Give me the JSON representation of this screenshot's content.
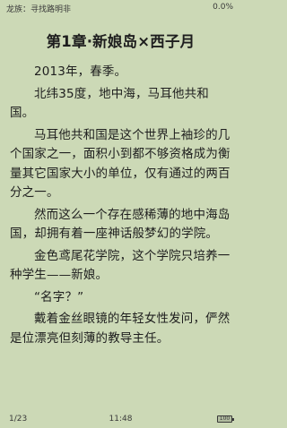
{
  "status_top": {
    "book_title": "龙族：寻找路明非",
    "progress": "0.0%"
  },
  "chapter": {
    "title": "第1章·新娘岛×西子月",
    "paragraphs": [
      "2013年，春季。",
      "北纬35度，地中海，马耳他共和国。",
      "马耳他共和国是这个世界上袖珍的几个国家之一，面积小到都不够资格成为衡量其它国家大小的单位，仅有通过的两百分之一。",
      "然而这么一个存在感稀薄的地中海岛国，却拥有着一座神话般梦幻的学院。",
      "金色鸢尾花学院，这个学院只培养一种学生——新娘。",
      "“名字？”",
      "戴着金丝眼镜的年轻女性发问，俨然是位漂亮但刻薄的教导主任。"
    ]
  },
  "status_bottom": {
    "page": "1/23",
    "time": "11:48",
    "battery_label": "100",
    "battery_level": 1.0
  }
}
